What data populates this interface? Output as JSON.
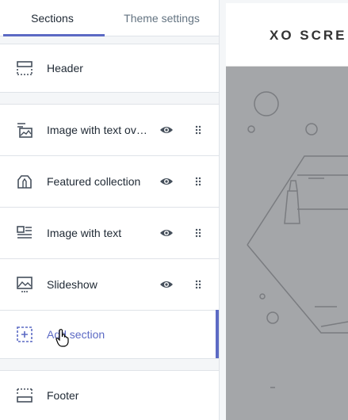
{
  "tabs": {
    "sections": "Sections",
    "theme_settings": "Theme settings"
  },
  "sections": {
    "header": {
      "label": "Header",
      "icon": "header-layout-icon"
    },
    "items": [
      {
        "label": "Image with text ov…",
        "icon": "image-text-overlay-icon"
      },
      {
        "label": "Featured collection",
        "icon": "collection-icon"
      },
      {
        "label": "Image with text",
        "icon": "image-with-text-icon"
      },
      {
        "label": "Slideshow",
        "icon": "slideshow-icon"
      }
    ],
    "add": {
      "label": "Add section",
      "icon": "add-section-icon"
    },
    "footer": {
      "label": "Footer",
      "icon": "footer-layout-icon"
    }
  },
  "preview": {
    "brand": "XO SCRE"
  },
  "colors": {
    "accent": "#5c6ac4",
    "text": "#212b36",
    "muted": "#637381",
    "hero_bg": "#a4a6a9"
  }
}
